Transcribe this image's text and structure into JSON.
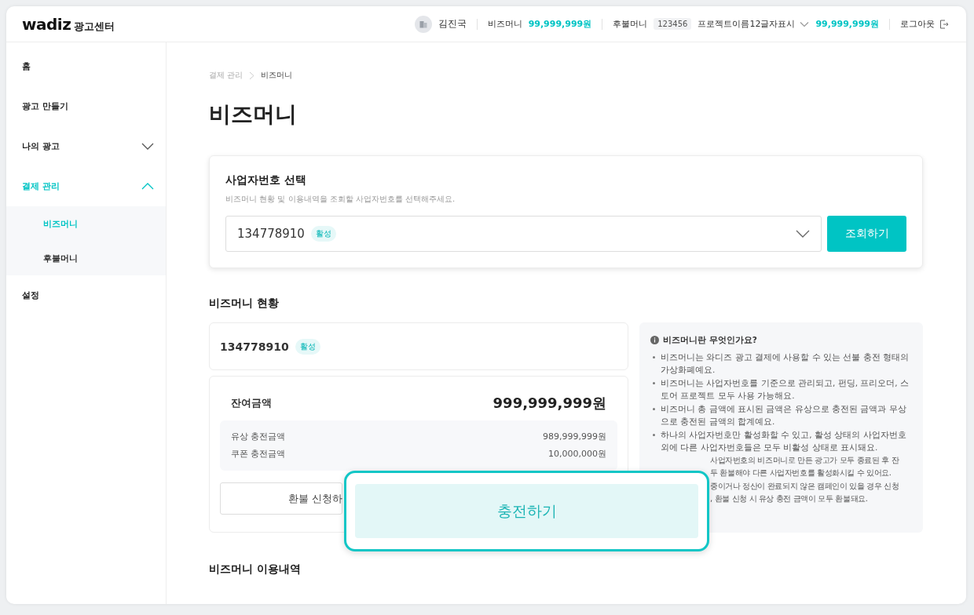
{
  "header": {
    "logo": "wadiz",
    "logo_suffix": "광고센터",
    "user": "김진국",
    "bizmoney_label": "비즈머니",
    "bizmoney_amount": "99,999,999원",
    "postpay_label": "후불머니",
    "project_code": "123456",
    "project_name": "프로젝트이름12글자표시",
    "postpay_amount": "99,999,999원",
    "logout": "로그아웃"
  },
  "sidebar": {
    "items": [
      {
        "label": "홈",
        "selected": false
      },
      {
        "label": "광고 만들기",
        "selected": false
      },
      {
        "label": "나의 광고",
        "selected": false,
        "expanded": false
      },
      {
        "label": "결제 관리",
        "selected": true,
        "expanded": true,
        "children": [
          {
            "label": "비즈머니",
            "selected": true
          },
          {
            "label": "후불머니",
            "selected": false
          }
        ]
      },
      {
        "label": "설정",
        "selected": false
      }
    ]
  },
  "breadcrumb": [
    "결제 관리",
    "비즈머니"
  ],
  "title": "비즈머니",
  "business_select": {
    "title": "사업자번호 선택",
    "hint": "비즈머니 현황 및 이용내역을 조회할 사업자번호를 선택해주세요.",
    "value": "134778910",
    "badge": "활성",
    "button": "조회하기"
  },
  "status": {
    "heading": "비즈머니 현황",
    "account": {
      "number": "134778910",
      "badge": "활성"
    },
    "balance": {
      "label": "잔여금액",
      "amount": "999,999,999원",
      "rows": [
        {
          "label": "유상 충전금액",
          "amount": "989,999,999원"
        },
        {
          "label": "쿠폰 충전금액",
          "amount": "10,000,000원"
        }
      ]
    },
    "refund_button": "환불 신청하",
    "info": {
      "title": "비즈머니란 무엇인가요?",
      "bullets": [
        "비즈머니는 와디즈 광고 결제에 사용할 수 있는 선불 충전 형태의 가상화폐예요.",
        "비즈머니는 사업자번호를 기준으로 관리되고, 펀딩, 프리오더, 스토어 프로젝트 모두 사용 가능해요.",
        "비즈머니 총 금액에 표시된 금액은 유상으로 충전된 금액과 무상으로 충전된 금액의 합계예요.",
        "하나의 사업자번호만 활성화할 수 있고, 활성 상태의 사업자번호 외에 다른 사업자번호들은 모두 비활성 상태로 표시돼요."
      ],
      "covered_lines": [
        "사업자번호의 비즈머니로 만든 광고가 모두 종료된 후 잔",
        "두 환불해야 다른 사업자번호를 활성화시킬 수 있어요.",
        "중이거나 정산이 완료되지 않은 캠페인이 있을 경우 신청",
        ", 환불 신청 시 유상 충전 금액이 모두 환불돼요."
      ]
    }
  },
  "history": {
    "heading": "비즈머니 이용내역"
  },
  "callout": {
    "button": "충전하기"
  }
}
